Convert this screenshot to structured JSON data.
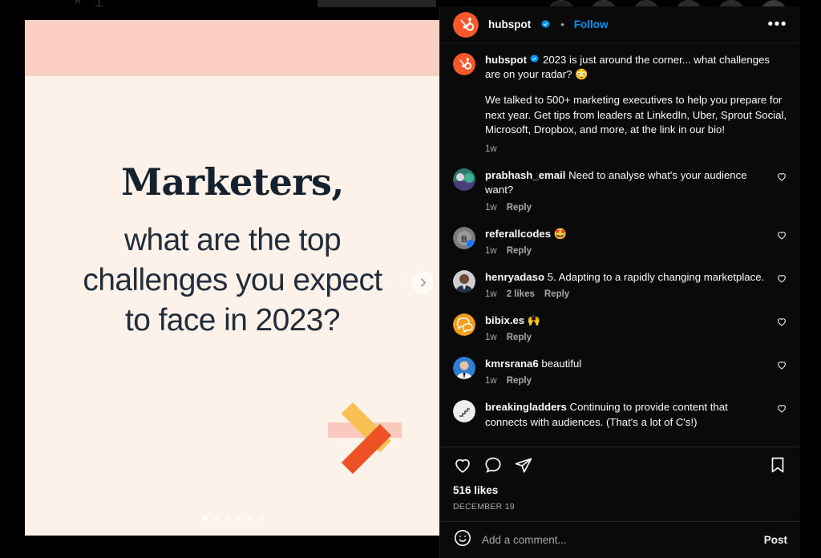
{
  "app": {
    "name": "Instagram",
    "theme": "dark"
  },
  "colors": {
    "panel_bg": "#0a0a0a",
    "accent_link": "#0095f6",
    "text_primary": "#fafafa",
    "text_secondary": "#a8a8a8",
    "brand_orange": "#f8761f",
    "media_bg": "#fdf2e9",
    "media_band": "#fbd0c4",
    "arrow_shaft": "#fac8bd",
    "arrow_yellow": "#f8bf53",
    "arrow_orange": "#ef5126"
  },
  "media": {
    "headline_serif": "Marketers,",
    "lines": [
      "what are the top",
      "challenges you expect",
      "to face in 2023?"
    ],
    "next_icon": "chevron-right-icon",
    "arrow_icon": "arrow-right-graphic",
    "carousel": {
      "total": 6,
      "active_index": 0
    }
  },
  "header": {
    "username": "hubspot",
    "verified_icon": "verified-badge-icon",
    "separator": "•",
    "follow_label": "Follow",
    "more_icon": "more-options-icon",
    "more_label": "•••"
  },
  "caption": {
    "username": "hubspot",
    "verified_icon": "verified-badge-icon",
    "line1": "2023 is just around the corner... what challenges are on your radar? 😳",
    "line2": "We talked to 500+ marketing executives to help you prepare for next year. Get tips from leaders at LinkedIn, Uber, Sprout Social, Microsoft, Dropbox, and more, at the link in our bio!",
    "timestamp": "1w"
  },
  "comments": [
    {
      "username": "prabhash_email",
      "text": " Need to analyse what's your audience want?",
      "timestamp": "1w",
      "likes": "",
      "reply_label": "Reply",
      "avatar_colors": [
        "#2c7a6e",
        "#4a3f7a"
      ],
      "like_icon": "heart-outline-icon"
    },
    {
      "username": "referallcodes",
      "text": " 🤩",
      "timestamp": "1w",
      "likes": "",
      "reply_label": "Reply",
      "avatar_colors": [
        "#8d8d8d",
        "#5a5a5a"
      ],
      "like_icon": "heart-outline-icon"
    },
    {
      "username": "henryadaso",
      "text": " 5. Adapting to a rapidly changing marketplace.",
      "timestamp": "1w",
      "likes": "2 likes",
      "reply_label": "Reply",
      "avatar_colors": [
        "#c9c9c9",
        "#6b4a33"
      ],
      "like_icon": "heart-outline-icon"
    },
    {
      "username": "bibix.es",
      "text": " 🙌",
      "timestamp": "1w",
      "likes": "",
      "reply_label": "Reply",
      "avatar_colors": [
        "#f29f1e",
        "#f29f1e"
      ],
      "like_icon": "heart-outline-icon"
    },
    {
      "username": "kmrsrana6",
      "text": " beautiful",
      "timestamp": "1w",
      "likes": "",
      "reply_label": "Reply",
      "avatar_colors": [
        "#2e7fd4",
        "#1d5fa8"
      ],
      "like_icon": "heart-outline-icon"
    },
    {
      "username": "breakingladders",
      "text": " Continuing to provide content that connects with audiences. (That's a lot of C's!)",
      "timestamp": "",
      "likes": "",
      "reply_label": "",
      "avatar_colors": [
        "#e8e8e8",
        "#cfcfcf"
      ],
      "like_icon": "heart-outline-icon"
    }
  ],
  "actions": {
    "like_icon": "heart-outline-icon",
    "comment_icon": "comment-bubble-icon",
    "share_icon": "share-paperplane-icon",
    "save_icon": "bookmark-outline-icon",
    "likes_count": "516 likes",
    "date": "DECEMBER 19"
  },
  "add_comment": {
    "emoji_icon": "emoji-smiley-icon",
    "placeholder": "Add a comment...",
    "value": "",
    "post_label": "Post"
  }
}
